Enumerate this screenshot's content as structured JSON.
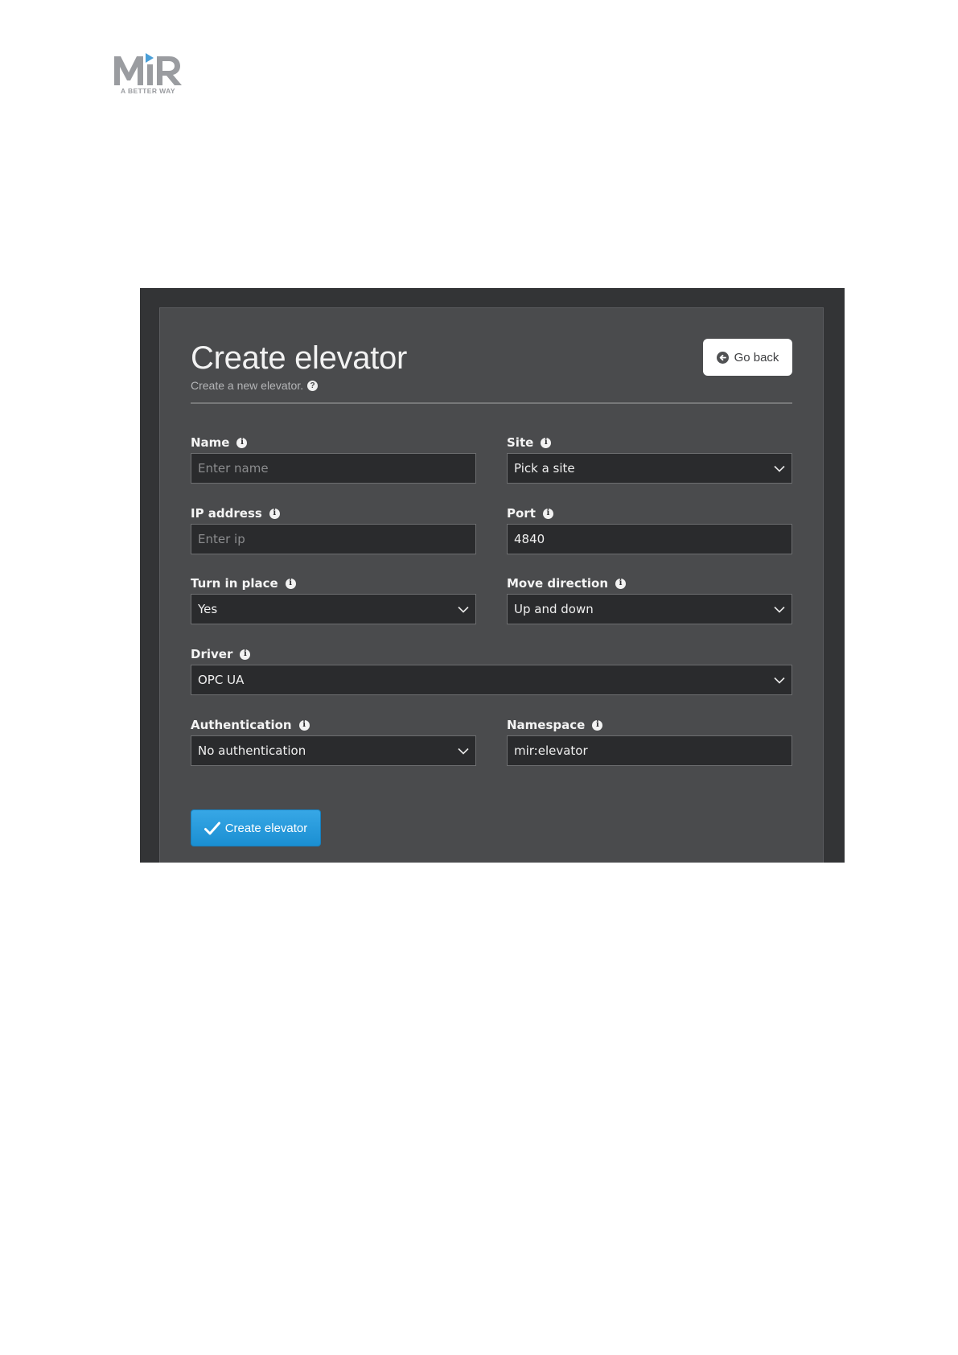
{
  "logo": {
    "wordmark": "MiR",
    "tagline": "A BETTER WAY"
  },
  "header": {
    "title": "Create elevator",
    "subtitle": "Create a new elevator.",
    "go_back_label": "Go back"
  },
  "form": {
    "name": {
      "label": "Name",
      "placeholder": "Enter name",
      "value": ""
    },
    "site": {
      "label": "Site",
      "value": "Pick a site"
    },
    "ip_address": {
      "label": "IP address",
      "placeholder": "Enter ip",
      "value": ""
    },
    "port": {
      "label": "Port",
      "value": "4840"
    },
    "turn_in_place": {
      "label": "Turn in place",
      "value": "Yes"
    },
    "move_direction": {
      "label": "Move direction",
      "value": "Up and down"
    },
    "driver": {
      "label": "Driver",
      "value": "OPC UA"
    },
    "authentication": {
      "label": "Authentication",
      "value": "No authentication"
    },
    "namespace": {
      "label": "Namespace",
      "value": "mir:elevator"
    }
  },
  "submit_label": "Create elevator",
  "icons": {
    "help": "question-circle-icon",
    "info": "info-icon",
    "back": "arrow-left-circle-icon",
    "dropdown": "chevron-down-icon",
    "submit": "checkmark-icon"
  },
  "colors": {
    "accent": "#1b8fd2",
    "panel_bg": "#4a4b4d",
    "field_bg": "#2a2b2d",
    "logo_gray": "#9a9ca0",
    "logo_blue": "#4a9fd8"
  }
}
